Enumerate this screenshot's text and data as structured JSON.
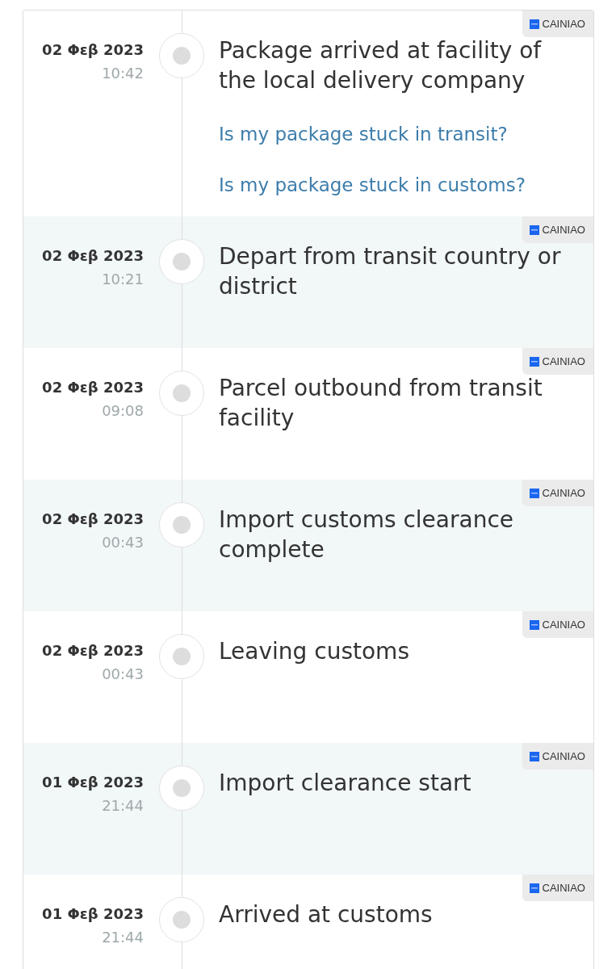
{
  "events": [
    {
      "date": "02 Φεβ 2023",
      "time": "10:42",
      "title": "Package arrived at facility of the local delivery company",
      "carrier": "CAINIAO",
      "links": [
        "Is my package stuck in transit?",
        "Is my package stuck in customs?"
      ]
    },
    {
      "date": "02 Φεβ 2023",
      "time": "10:21",
      "title": "Depart from transit country or district",
      "carrier": "CAINIAO"
    },
    {
      "date": "02 Φεβ 2023",
      "time": "09:08",
      "title": "Parcel outbound from transit facility",
      "carrier": "CAINIAO"
    },
    {
      "date": "02 Φεβ 2023",
      "time": "00:43",
      "title": "Import customs clearance complete",
      "carrier": "CAINIAO"
    },
    {
      "date": "02 Φεβ 2023",
      "time": "00:43",
      "title": "Leaving customs",
      "carrier": "CAINIAO"
    },
    {
      "date": "01 Φεβ 2023",
      "time": "21:44",
      "title": "Import clearance start",
      "carrier": "CAINIAO"
    },
    {
      "date": "01 Φεβ 2023",
      "time": "21:44",
      "title": "Arrived at customs",
      "carrier": "CAINIAO"
    }
  ]
}
